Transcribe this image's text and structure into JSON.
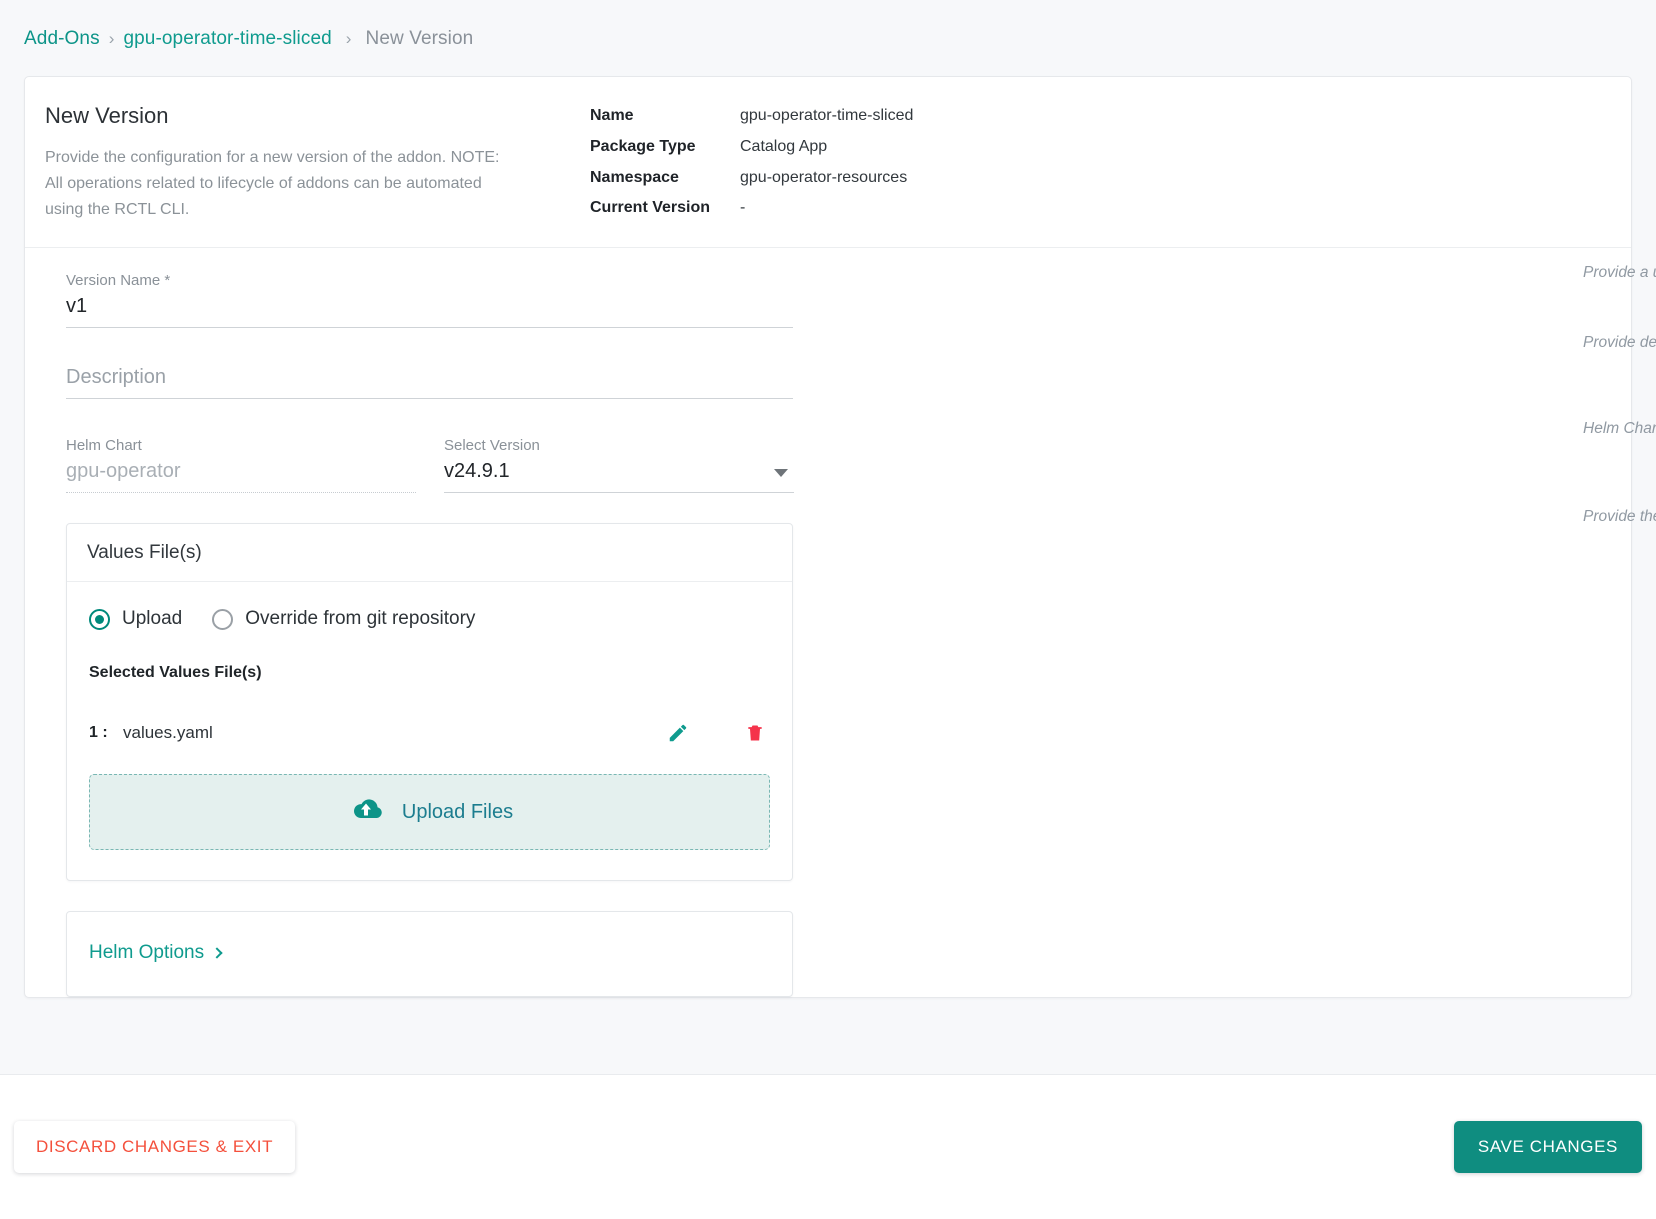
{
  "breadcrumb": {
    "root": "Add-Ons",
    "addon": "gpu-operator-time-sliced",
    "current": "New Version",
    "separator": "›"
  },
  "header": {
    "title": "New Version",
    "description": "Provide the configuration for a new version of the addon. NOTE: All operations related to lifecycle of addons can be automated using the RCTL CLI.",
    "meta": [
      {
        "key": "Name",
        "value": "gpu-operator-time-sliced"
      },
      {
        "key": "Package Type",
        "value": "Catalog App"
      },
      {
        "key": "Namespace",
        "value": "gpu-operator-resources"
      },
      {
        "key": "Current Version",
        "value": "-"
      }
    ]
  },
  "form": {
    "version_name": {
      "label": "Version Name *",
      "value": "v1",
      "hint": "Provide a unique version name for version control purposes"
    },
    "description": {
      "label": "",
      "placeholder": "Description",
      "value": "",
      "hint": "Provide description for the addon"
    },
    "helm_chart": {
      "label": "Helm Chart",
      "value": "gpu-operator",
      "hint": "Helm Chart name of the Catalog App"
    },
    "select_version": {
      "label": "Select Version",
      "value": "v24.9.1"
    }
  },
  "values_files": {
    "title": "Values File(s)",
    "hint": "Provide the values.yaml files to be used with the Helm chart",
    "source_options": [
      {
        "label": "Upload",
        "selected": true
      },
      {
        "label": "Override from git repository",
        "selected": false
      }
    ],
    "selected_title": "Selected Values File(s)",
    "files": [
      {
        "index": "1 :",
        "name": "values.yaml"
      }
    ],
    "upload_button": "Upload Files"
  },
  "helm_options": {
    "label": "Helm Options"
  },
  "footer": {
    "discard": "DISCARD CHANGES & EXIT",
    "save": "SAVE CHANGES"
  },
  "colors": {
    "accent": "#0f9b8e",
    "save_button": "#0f8d80",
    "danger": "#f4503c",
    "delete_icon": "#f5334b",
    "upload_cloud": "#0d9488",
    "upload_text": "#1c7d8f",
    "dropzone_bg": "#e4f0ee",
    "page_bg": "#f7f8fa"
  }
}
